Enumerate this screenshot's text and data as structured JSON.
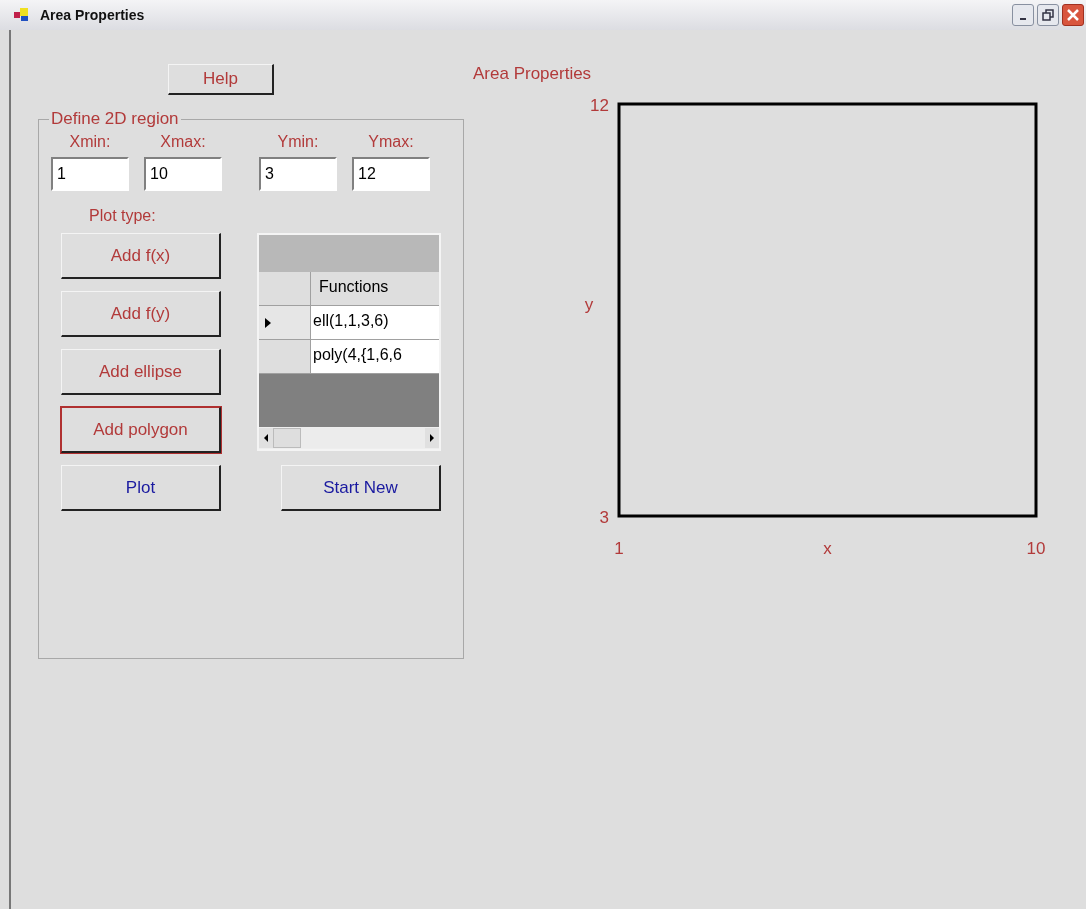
{
  "window": {
    "title": "Area Properties"
  },
  "help_button": {
    "label": "Help"
  },
  "heading": "Area Properties",
  "region": {
    "legend": "Define 2D region",
    "fields": [
      {
        "label": "Xmin:",
        "value": "1"
      },
      {
        "label": "Xmax:",
        "value": "10"
      },
      {
        "label": "Ymin:",
        "value": "3"
      },
      {
        "label": "Ymax:",
        "value": "12"
      }
    ],
    "plot_type_label": "Plot type:",
    "buttons": [
      {
        "label": "Add f(x)",
        "kind": "plot-type",
        "focused": false
      },
      {
        "label": "Add f(y)",
        "kind": "plot-type",
        "focused": false
      },
      {
        "label": "Add ellipse",
        "kind": "plot-type",
        "focused": false
      },
      {
        "label": "Add polygon",
        "kind": "plot-type",
        "focused": true
      }
    ],
    "functions_grid": {
      "column": "Functions",
      "rows": [
        {
          "value": "ell(1,1,3,6)",
          "selected": true
        },
        {
          "value": "poly(4,{1,6,6",
          "selected": false
        }
      ]
    },
    "actions": [
      {
        "label": "Plot",
        "kind": "action"
      },
      {
        "label": "Start New",
        "kind": "action"
      }
    ]
  },
  "plot": {
    "chart_data": {
      "type": "line",
      "xlabel": "x",
      "ylabel": "y",
      "xlim": [
        1,
        10
      ],
      "ylim": [
        3,
        12
      ],
      "xticks": [
        1,
        10
      ],
      "yticks": [
        3,
        12
      ]
    }
  }
}
